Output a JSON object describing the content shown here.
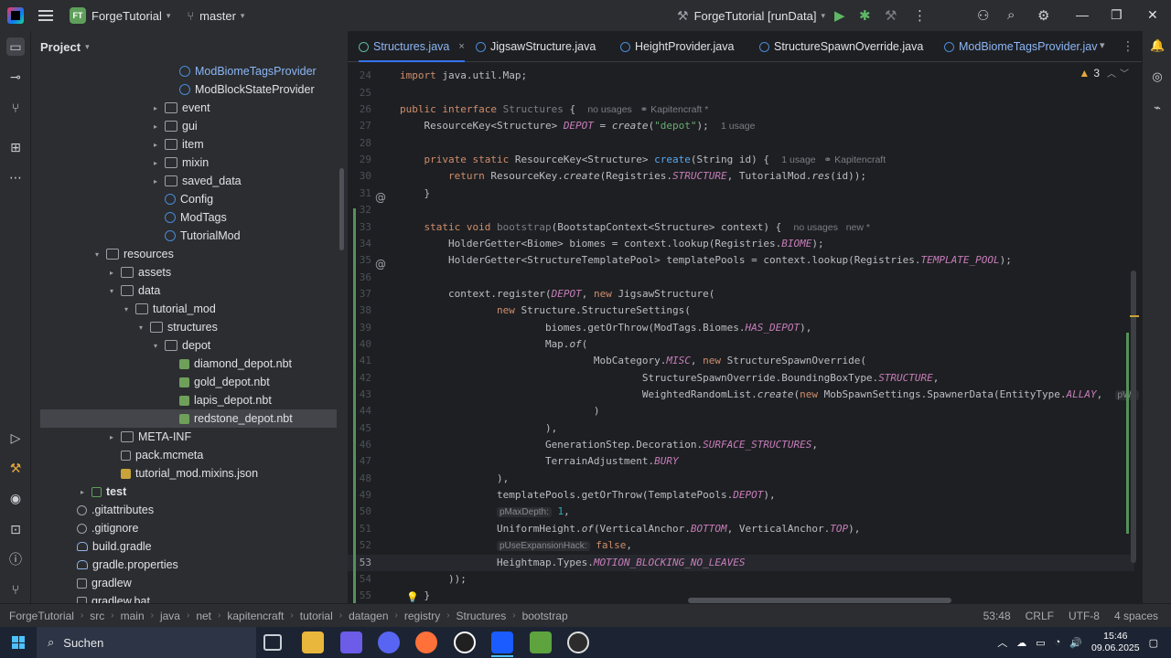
{
  "titlebar": {
    "project_badge": "FT",
    "project_name": "ForgeTutorial",
    "branch": "master",
    "run_config": "ForgeTutorial [runData]"
  },
  "project_panel": {
    "title": "Project",
    "tree": [
      {
        "label": "ModBiomeTagsProvider",
        "type": "class",
        "indent": 9,
        "arrow": "",
        "style": "blue"
      },
      {
        "label": "ModBlockStateProvider",
        "type": "class",
        "indent": 9,
        "arrow": "",
        "style": ""
      },
      {
        "label": "event",
        "type": "pkg",
        "indent": 8,
        "arrow": ">",
        "style": ""
      },
      {
        "label": "gui",
        "type": "pkg",
        "indent": 8,
        "arrow": ">",
        "style": ""
      },
      {
        "label": "item",
        "type": "pkg",
        "indent": 8,
        "arrow": ">",
        "style": ""
      },
      {
        "label": "mixin",
        "type": "pkg",
        "indent": 8,
        "arrow": ">",
        "style": ""
      },
      {
        "label": "saved_data",
        "type": "pkg",
        "indent": 8,
        "arrow": ">",
        "style": ""
      },
      {
        "label": "Config",
        "type": "class",
        "indent": 8,
        "arrow": "",
        "style": ""
      },
      {
        "label": "ModTags",
        "type": "class",
        "indent": 8,
        "arrow": "",
        "style": ""
      },
      {
        "label": "TutorialMod",
        "type": "class",
        "indent": 8,
        "arrow": "",
        "style": ""
      },
      {
        "label": "resources",
        "type": "folder",
        "indent": 4,
        "arrow": "v",
        "style": ""
      },
      {
        "label": "assets",
        "type": "folder",
        "indent": 5,
        "arrow": ">",
        "style": ""
      },
      {
        "label": "data",
        "type": "folder",
        "indent": 5,
        "arrow": "v",
        "style": ""
      },
      {
        "label": "tutorial_mod",
        "type": "folder",
        "indent": 6,
        "arrow": "v",
        "style": ""
      },
      {
        "label": "structures",
        "type": "folder",
        "indent": 7,
        "arrow": "v",
        "style": ""
      },
      {
        "label": "depot",
        "type": "folder",
        "indent": 8,
        "arrow": "v",
        "style": ""
      },
      {
        "label": "diamond_depot.nbt",
        "type": "nbt",
        "indent": 9,
        "arrow": "",
        "style": ""
      },
      {
        "label": "gold_depot.nbt",
        "type": "nbt",
        "indent": 9,
        "arrow": "",
        "style": ""
      },
      {
        "label": "lapis_depot.nbt",
        "type": "nbt",
        "indent": 9,
        "arrow": "",
        "style": ""
      },
      {
        "label": "redstone_depot.nbt",
        "type": "nbt",
        "indent": 9,
        "arrow": "",
        "style": "selected"
      },
      {
        "label": "META-INF",
        "type": "folder",
        "indent": 5,
        "arrow": ">",
        "style": ""
      },
      {
        "label": "pack.mcmeta",
        "type": "mc",
        "indent": 5,
        "arrow": "",
        "style": ""
      },
      {
        "label": "tutorial_mod.mixins.json",
        "type": "json",
        "indent": 5,
        "arrow": "",
        "style": ""
      },
      {
        "label": "test",
        "type": "test",
        "indent": 3,
        "arrow": ">",
        "style": "bold"
      },
      {
        "label": ".gitattributes",
        "type": "git",
        "indent": 2,
        "arrow": "",
        "style": ""
      },
      {
        "label": ".gitignore",
        "type": "git",
        "indent": 2,
        "arrow": "",
        "style": ""
      },
      {
        "label": "build.gradle",
        "type": "grad",
        "indent": 2,
        "arrow": "",
        "style": ""
      },
      {
        "label": "gradle.properties",
        "type": "grad",
        "indent": 2,
        "arrow": "",
        "style": ""
      },
      {
        "label": "gradlew",
        "type": "mc",
        "indent": 2,
        "arrow": "",
        "style": ""
      },
      {
        "label": "gradlew.bat",
        "type": "mc",
        "indent": 2,
        "arrow": "",
        "style": ""
      }
    ]
  },
  "tabs": [
    {
      "label": "Structures.java",
      "active": true,
      "close": "×"
    },
    {
      "label": "JigsawStructure.java",
      "active": false
    },
    {
      "label": "HeightProvider.java",
      "active": false
    },
    {
      "label": "StructureSpawnOverride.java",
      "active": false
    },
    {
      "label": "ModBiomeTagsProvider.jav",
      "active": false
    }
  ],
  "inspection": {
    "count": "3"
  },
  "code_lines": [
    {
      "n": "23",
      "html": ""
    },
    {
      "n": "24",
      "html": "<span class='kw'>import</span> java.util.Map;"
    },
    {
      "n": "25",
      "html": ""
    },
    {
      "n": "26",
      "html": "<span class='kw'>public interface</span> <span class='gray'>Structures</span> {  <span class='hint'>no usages   ⚭ Kapitencraft *</span>"
    },
    {
      "n": "27",
      "html": "    ResourceKey&lt;Structure&gt; <span class='cn'>DEPOT</span> = <span class='it'>create</span>(<span class='st'>\"depot\"</span>);  <span class='hint'>1 usage</span>"
    },
    {
      "n": "28",
      "html": ""
    },
    {
      "n": "29",
      "html": "    <span class='kw'>private static</span> ResourceKey&lt;Structure&gt; <span class='fn'>create</span>(String id) {  <span class='hint'>1 usage   ⚭ Kapitencraft</span>"
    },
    {
      "n": "30",
      "html": "        <span class='kw'>return</span> ResourceKey.<span class='it'>create</span>(Registries.<span class='cn'>STRUCTURE</span>, TutorialMod.<span class='it'>res</span>(id));"
    },
    {
      "n": "31",
      "html": "    }"
    },
    {
      "n": "32",
      "html": ""
    },
    {
      "n": "33",
      "html": "    <span class='kw'>static void</span> <span class='gray'>bootstrap</span>(BootstapContext&lt;Structure&gt; context) {  <span class='hint'>no usages   new *</span>"
    },
    {
      "n": "34",
      "html": "        HolderGetter&lt;Biome&gt; biomes = context.lookup(Registries.<span class='cn'>BIOME</span>);"
    },
    {
      "n": "35",
      "html": "        HolderGetter&lt;StructureTemplatePool&gt; templatePools = context.lookup(Registries.<span class='cn'>TEMPLATE_POOL</span>);"
    },
    {
      "n": "36",
      "html": ""
    },
    {
      "n": "37",
      "html": "        context.register(<span class='cn'>DEPOT</span>, <span class='kw'>new</span> JigsawStructure("
    },
    {
      "n": "38",
      "html": "                <span class='kw'>new</span> Structure.StructureSettings("
    },
    {
      "n": "39",
      "html": "                        biomes.getOrThrow(ModTags.Biomes.<span class='cn'>HAS_DEPOT</span>),"
    },
    {
      "n": "40",
      "html": "                        Map.<span class='it'>of</span>("
    },
    {
      "n": "41",
      "html": "                                MobCategory.<span class='cn'>MISC</span>, <span class='kw'>new</span> StructureSpawnOverride("
    },
    {
      "n": "42",
      "html": "                                        StructureSpawnOverride.BoundingBoxType.<span class='cn'>STRUCTURE</span>,"
    },
    {
      "n": "43",
      "html": "                                        WeightedRandomList.<span class='it'>create</span>(<span class='kw'>new</span> MobSpawnSettings.SpawnerData(EntityType.<span class='cn'>ALLAY</span>,  <span class='inlay'>pWe</span>"
    },
    {
      "n": "44",
      "html": "                                )"
    },
    {
      "n": "45",
      "html": "                        ),"
    },
    {
      "n": "46",
      "html": "                        GenerationStep.Decoration.<span class='cn'>SURFACE_STRUCTURES</span>,"
    },
    {
      "n": "47",
      "html": "                        TerrainAdjustment.<span class='cn'>BURY</span>"
    },
    {
      "n": "48",
      "html": "                ),"
    },
    {
      "n": "49",
      "html": "                templatePools.getOrThrow(TemplatePools.<span class='cn'>DEPOT</span>),"
    },
    {
      "n": "50",
      "html": "                <span class='inlay'>pMaxDepth:</span> <span class='num'>1</span>,"
    },
    {
      "n": "51",
      "html": "                UniformHeight.<span class='it'>of</span>(VerticalAnchor.<span class='cn'>BOTTOM</span>, VerticalAnchor.<span class='cn'>TOP</span>),"
    },
    {
      "n": "52",
      "html": "                <span class='inlay'>pUseExpansionHack:</span> <span class='kw'>false</span>,"
    },
    {
      "n": "53",
      "html": "                Heightmap.Types.<span class='cn'>MOTION_BLOCKING_NO_LEAVES</span>"
    },
    {
      "n": "54",
      "html": "        ));"
    },
    {
      "n": "55",
      "html": "    }"
    }
  ],
  "statusbar": {
    "crumbs": [
      "ForgeTutorial",
      "src",
      "main",
      "java",
      "net",
      "kapitencraft",
      "tutorial",
      "datagen",
      "registry",
      "Structures",
      "bootstrap"
    ],
    "position": "53:48",
    "line_sep": "CRLF",
    "encoding": "UTF-8",
    "indent": "4 spaces"
  },
  "taskbar": {
    "search": "Suchen",
    "time": "15:46",
    "date": "09.06.2025"
  },
  "colors": {
    "accent": "#3574f0",
    "keyword": "#cf8e6d",
    "constant": "#c77dbb",
    "string": "#6aab73"
  }
}
